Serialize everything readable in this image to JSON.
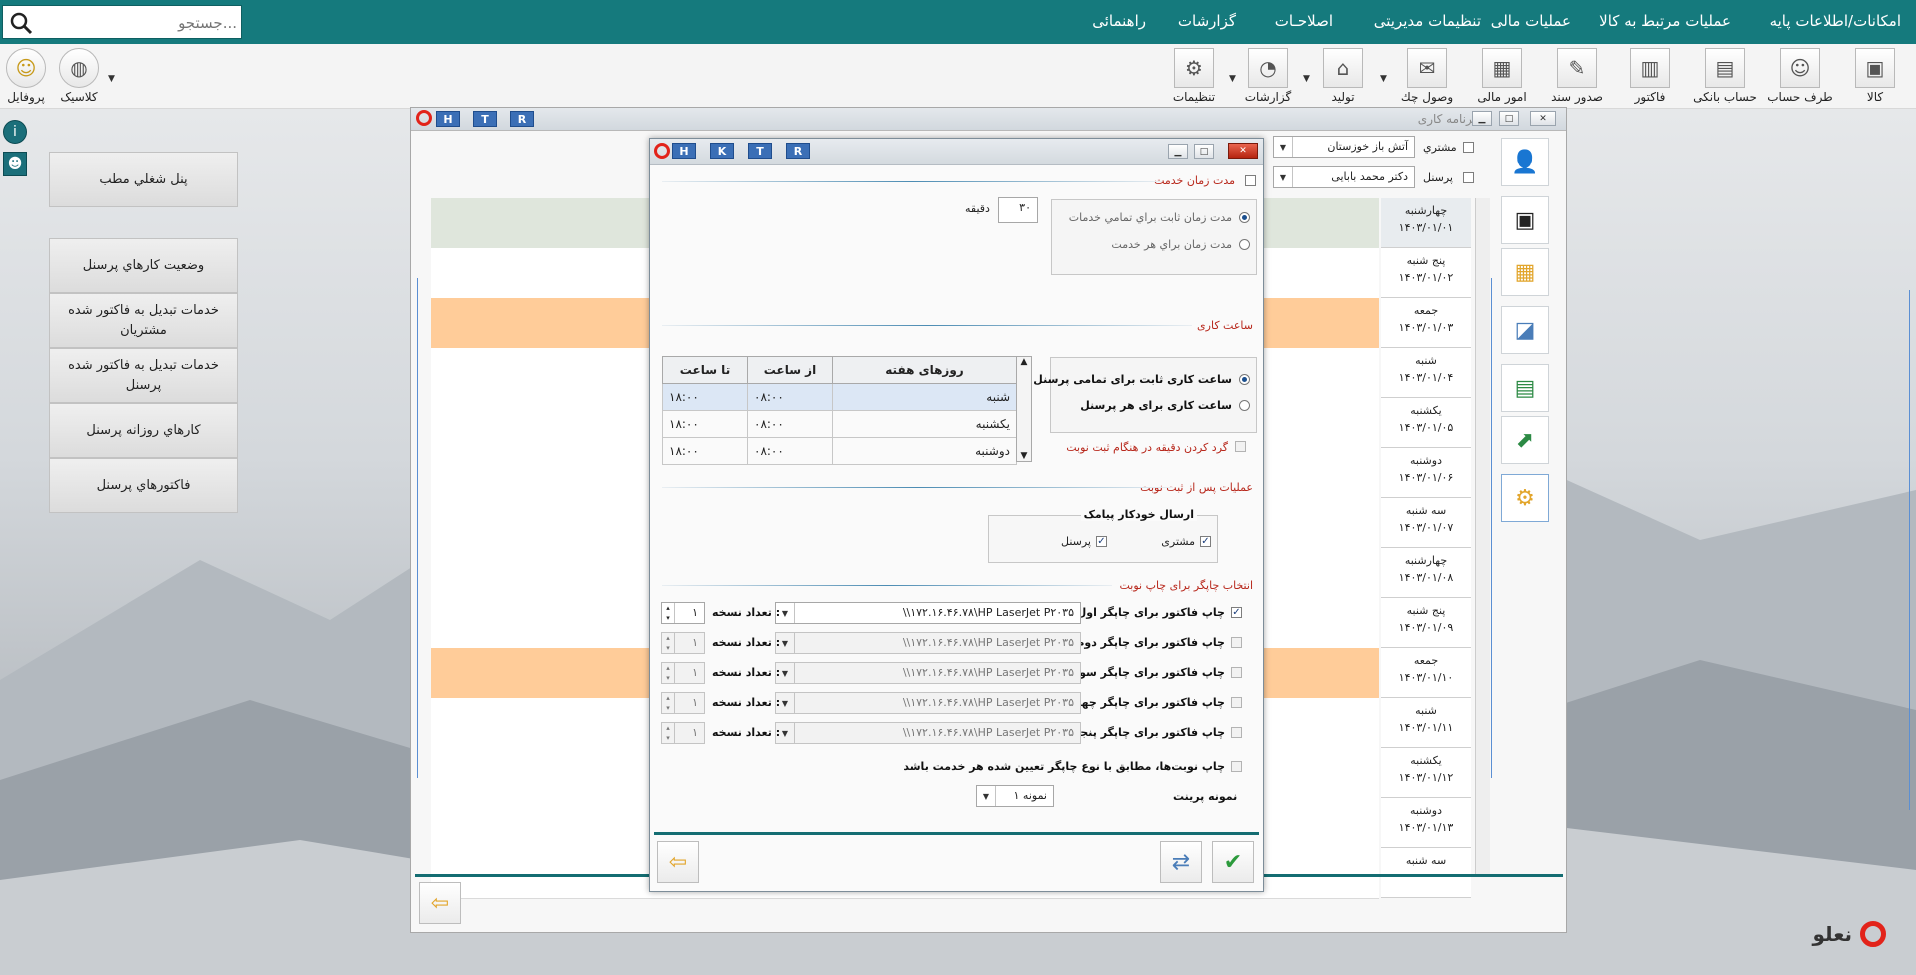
{
  "menu": {
    "items": [
      "امکانات/اطلاعات پایه",
      "عملیات مرتبط به کالا",
      "عملیات مالی",
      "تنظیمات مدیریتی",
      "اصلاحـات",
      "گزارشات",
      "راهنمائی"
    ],
    "search_placeholder": "جستجو..."
  },
  "toolbar": {
    "items": [
      "کالا",
      "طرف حساب",
      "حساب بانکی",
      "فاکتور",
      "صدور سند",
      "امور مالی",
      "وصول چك",
      "تولید",
      "گزارشات",
      "تنظیمات"
    ],
    "left_items": [
      "پروفایل",
      "کلاسیک"
    ]
  },
  "side_panel": {
    "buttons": [
      "پنل شغلي مطب",
      "وضعیت کارهاي پرسنل",
      "خدمات تبدیل به فاکتور شده مشتریان",
      "خدمات تبدیل به فاکتور شده پرسنل",
      "کارهاي روزانه  پرسنل",
      "فاکتورهاي پرسنل"
    ]
  },
  "main_window": {
    "title": "برنامه کاری",
    "buttons": [
      "H",
      "T",
      "R"
    ],
    "filter_customer_label": "مشتري",
    "filter_customer_value": "آتش باز خوزستان",
    "filter_staff_label": "پرسنل",
    "filter_staff_value": "دکتر محمد بابایی",
    "days": [
      {
        "day": "چهارشنبه",
        "date": "۱۴۰۳/۰۱/۰۱"
      },
      {
        "day": "پنج شنبه",
        "date": "۱۴۰۳/۰۱/۰۲"
      },
      {
        "day": "جمعه",
        "date": "۱۴۰۳/۰۱/۰۳"
      },
      {
        "day": "شنبه",
        "date": "۱۴۰۳/۰۱/۰۴"
      },
      {
        "day": "یکشنبه",
        "date": "۱۴۰۳/۰۱/۰۵"
      },
      {
        "day": "دوشنبه",
        "date": "۱۴۰۳/۰۱/۰۶"
      },
      {
        "day": "سه شنبه",
        "date": "۱۴۰۳/۰۱/۰۷"
      },
      {
        "day": "چهارشنبه",
        "date": "۱۴۰۳/۰۱/۰۸"
      },
      {
        "day": "پنج شنبه",
        "date": "۱۴۰۳/۰۱/۰۹"
      },
      {
        "day": "جمعه",
        "date": "۱۴۰۳/۰۱/۱۰"
      },
      {
        "day": "شنبه",
        "date": "۱۴۰۳/۰۱/۱۱"
      },
      {
        "day": "یکشنبه",
        "date": "۱۴۰۳/۰۱/۱۲"
      },
      {
        "day": "دوشنبه",
        "date": "۱۴۰۳/۰۱/۱۳"
      },
      {
        "day": "سه شنبه",
        "date": ""
      }
    ]
  },
  "dialog": {
    "buttons": [
      "H",
      "K",
      "T",
      "R"
    ],
    "service_time": {
      "label": "مدت زمان خدمت",
      "opt_fixed": "مدت زمان ثابت براي تمامي خدمات",
      "opt_each": "مدت زمان براي هر خدمت",
      "minutes_value": "۳۰",
      "minutes_unit": "دقیقه"
    },
    "work_hours": {
      "label": "ساعت کاری",
      "opt_fixed": "ساعت کاری ثابت برای تمامی پرسنل",
      "opt_each": "ساعت کاری برای هر پرسنل",
      "round_label": "گرد کردن دقیقه در هنگام ثبت نوبت",
      "columns": [
        "روزهای هفته",
        "از ساعت",
        "تا ساعت"
      ],
      "rows": [
        [
          "شنبه",
          "۰۸:۰۰",
          "۱۸:۰۰"
        ],
        [
          "یکشنبه",
          "۰۸:۰۰",
          "۱۸:۰۰"
        ],
        [
          "دوشنبه",
          "۰۸:۰۰",
          "۱۸:۰۰"
        ]
      ]
    },
    "after_booking": {
      "label": "عملیات پس از ثبت نوبت",
      "sms_group": "ارسال خودکار پیامک",
      "sms_customer": "مشتری",
      "sms_staff": "پرسنل"
    },
    "printer": {
      "label": "انتخاب چاپگر برای چاپ نوبت",
      "copies_label": "تعداد نسخه :",
      "printer_value": "\\\\۱۷۲.۱۶.۴۶.۷۸\\HP LaserJet P۲۰۳۵",
      "copies_value": "۱",
      "rows": [
        "چاپ فاکتور برای چاپگر اول",
        "چاپ فاکتور برای چاپگر دوم",
        "چاپ فاکتور برای چاپگر سوم",
        "چاپ فاکتور برای چاپگر چهارم",
        "چاپ فاکتور برای چاپگر پنجم"
      ],
      "match_label": "چاپ نوبت‌ها، مطابق با نوع چاپگر تعیین شده هر خدمت باشد",
      "sample_label": "نمونه پرینت",
      "sample_value": "نمونه ۱"
    }
  },
  "brand": "نعلو",
  "colors": {
    "teal": "#157a7d",
    "accent_red": "#b8281c",
    "orange_row": "#ffcc99"
  }
}
